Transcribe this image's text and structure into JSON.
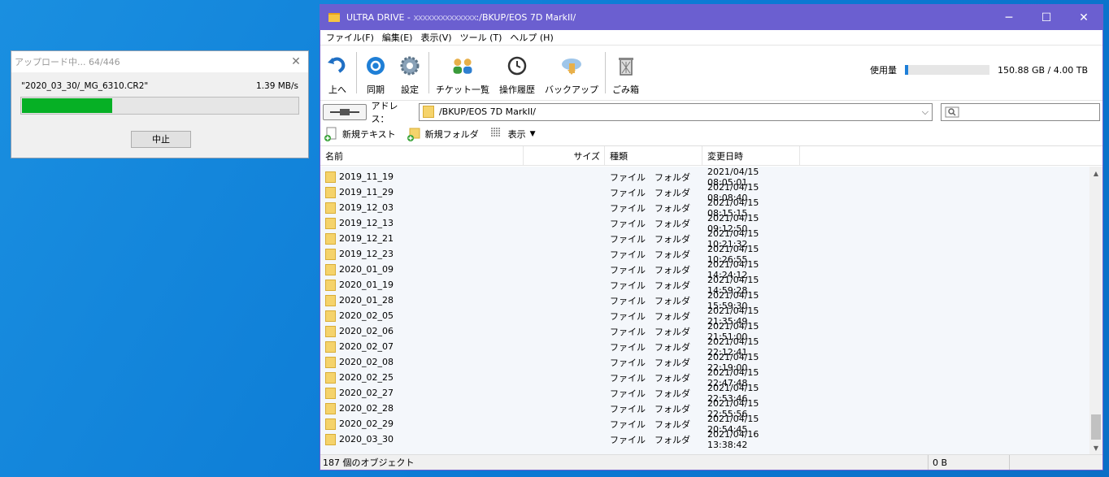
{
  "colors": {
    "titlebar": "#6b5fd0",
    "progress": "#06b025",
    "folder": "#f5d36b",
    "usage_fill": "#1e7fd8"
  },
  "upload": {
    "title": "アップロード中... 64/446",
    "filename": "\"2020_03_30/_MG_6310.CR2\"",
    "speed": "1.39 MB/s",
    "progress_fraction": 0.33,
    "stop_label": "中止"
  },
  "window": {
    "title_prefix": "ULTRA DRIVE - ",
    "title_obscured": "xxxxxxxxxxxxxx",
    "title_suffix": ":/BKUP/EOS 7D MarkII/"
  },
  "menu": [
    "ファイル(F)",
    "編集(E)",
    "表示(V)",
    "ツール (T)",
    "ヘルプ (H)"
  ],
  "toolbar": {
    "up": "上へ",
    "sync": "同期",
    "settings": "設定",
    "tickets": "チケット一覧",
    "history": "操作履歴",
    "backup": "バックアップ",
    "trash": "ごみ箱"
  },
  "usage": {
    "label": "使用量",
    "value": "150.88 GB / 4.00 TB",
    "fraction": 0.037
  },
  "address": {
    "label": "アドレス：",
    "value": "/BKUP/EOS 7D MarkII/",
    "search_placeholder": ""
  },
  "commands": {
    "new_text": "新規テキスト",
    "new_folder": "新規フォルダ",
    "view": "表示"
  },
  "columns": {
    "name": "名前",
    "size": "サイズ",
    "type": "種類",
    "modified": "変更日時"
  },
  "files": [
    {
      "name": "2019_11_19",
      "type": "ファイル　フォルダ",
      "date": "2021/04/15 08:05:01"
    },
    {
      "name": "2019_11_29",
      "type": "ファイル　フォルダ",
      "date": "2021/04/15 08:08:40"
    },
    {
      "name": "2019_12_03",
      "type": "ファイル　フォルダ",
      "date": "2021/04/15 08:15:15"
    },
    {
      "name": "2019_12_13",
      "type": "ファイル　フォルダ",
      "date": "2021/04/15 09:12:50"
    },
    {
      "name": "2019_12_21",
      "type": "ファイル　フォルダ",
      "date": "2021/04/15 10:21:32"
    },
    {
      "name": "2019_12_23",
      "type": "ファイル　フォルダ",
      "date": "2021/04/15 10:26:55"
    },
    {
      "name": "2020_01_09",
      "type": "ファイル　フォルダ",
      "date": "2021/04/15 14:24:12"
    },
    {
      "name": "2020_01_19",
      "type": "ファイル　フォルダ",
      "date": "2021/04/15 14:59:28"
    },
    {
      "name": "2020_01_28",
      "type": "ファイル　フォルダ",
      "date": "2021/04/15 15:59:30"
    },
    {
      "name": "2020_02_05",
      "type": "ファイル　フォルダ",
      "date": "2021/04/15 21:35:49"
    },
    {
      "name": "2020_02_06",
      "type": "ファイル　フォルダ",
      "date": "2021/04/15 21:51:00"
    },
    {
      "name": "2020_02_07",
      "type": "ファイル　フォルダ",
      "date": "2021/04/15 22:12:41"
    },
    {
      "name": "2020_02_08",
      "type": "ファイル　フォルダ",
      "date": "2021/04/15 22:19:00"
    },
    {
      "name": "2020_02_25",
      "type": "ファイル　フォルダ",
      "date": "2021/04/15 22:47:48"
    },
    {
      "name": "2020_02_27",
      "type": "ファイル　フォルダ",
      "date": "2021/04/15 22:53:46"
    },
    {
      "name": "2020_02_28",
      "type": "ファイル　フォルダ",
      "date": "2021/04/15 22:55:56"
    },
    {
      "name": "2020_02_29",
      "type": "ファイル　フォルダ",
      "date": "2021/04/15 20:54:45"
    },
    {
      "name": "2020_03_30",
      "type": "ファイル　フォルダ",
      "date": "2021/04/16 13:38:42"
    }
  ],
  "status": {
    "count": "187 個のオブジェクト",
    "size": "0 B"
  }
}
